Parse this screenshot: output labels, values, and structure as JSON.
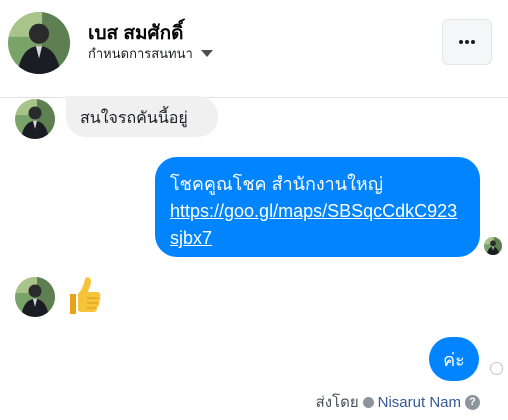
{
  "header": {
    "name": "เบส สมศักดิ์",
    "subtitle": "กำหนดการสนทนา",
    "more_label": "•••"
  },
  "messages": {
    "incoming_text": "สนใจรถคันนี้อยู่",
    "outgoing_line1": "โชคคูณโชค สำนักงานใหญ่",
    "outgoing_link": "https://goo.gl/maps/SBSqcCdkC923sjbx7",
    "reply": "ค่ะ",
    "reaction": "like-thumb-icon"
  },
  "footer": {
    "sent_by_label": "ส่งโดย",
    "sender_name": "Nisarut Nam",
    "help_label": "?"
  },
  "colors": {
    "accent": "#0084ff",
    "incoming_bubble": "#f0f0f0"
  }
}
